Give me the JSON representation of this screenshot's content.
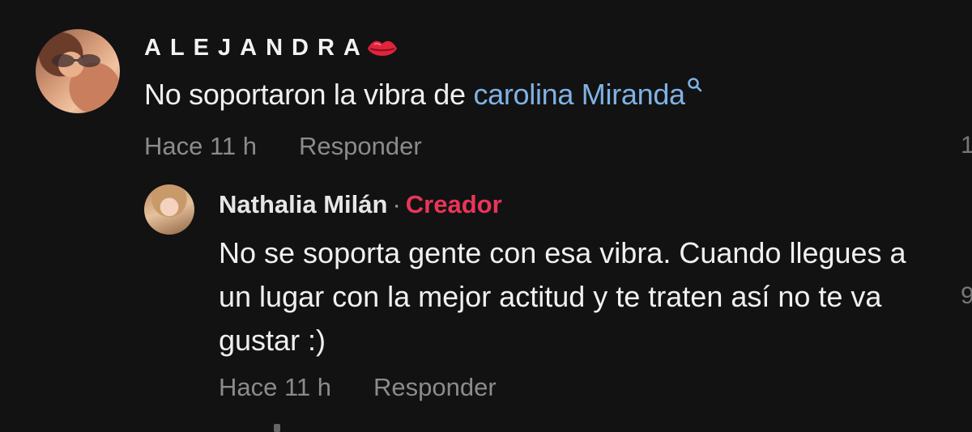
{
  "comment": {
    "username": "ALEJANDRA",
    "username_emoji": "lips-icon",
    "text_prefix": "No soportaron la vibra de ",
    "mention": "carolina Miranda",
    "mention_icon": "search-icon",
    "time": "Hace 11 h",
    "reply_label": "Responder",
    "side_count_fragment": "1"
  },
  "reply": {
    "username": "Nathalia Milán",
    "separator": "·",
    "badge": "Creador",
    "text": "No se soporta gente con esa vibra. Cuando llegues a un lugar con la mejor actitud y te traten así no te va gustar :)",
    "time": "Hace 11 h",
    "reply_label": "Responder",
    "side_count_fragment": "9"
  },
  "colors": {
    "background": "#121212",
    "mention": "#7fb2e5",
    "creator_badge": "#ea3558",
    "meta_text": "#8b8b8b",
    "lips": "#e0243c"
  }
}
